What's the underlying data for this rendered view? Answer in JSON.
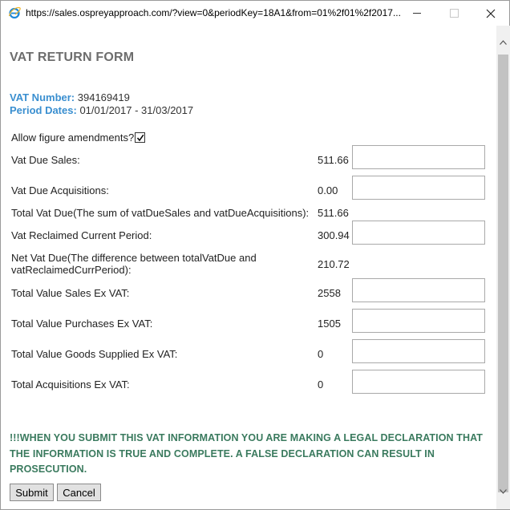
{
  "window": {
    "url": "https://sales.ospreyapproach.com/?view=0&periodKey=18A1&from=01%2f01%2f2017..."
  },
  "form": {
    "title": "VAT RETURN FORM",
    "vat_number_label": "VAT Number:",
    "vat_number": "394169419",
    "period_label": "Period Dates:",
    "period": "01/01/2017 - 31/03/2017",
    "allow_amend_label": "Allow figure amendments?",
    "allow_amend_checked": true,
    "fields": [
      {
        "label": "Vat Due Sales:",
        "value": "511.66",
        "has_input": true,
        "input_value": ""
      },
      {
        "label": "Vat Due Acquisitions:",
        "value": "0.00",
        "has_input": true,
        "input_value": ""
      },
      {
        "label": "Total Vat Due(The sum of vatDueSales and vatDueAcquisitions):",
        "value": "511.66",
        "has_input": false
      },
      {
        "label": "Vat Reclaimed Current Period:",
        "value": "300.94",
        "has_input": true,
        "input_value": ""
      },
      {
        "label": "Net Vat Due(The difference between totalVatDue and vatReclaimedCurrPeriod):",
        "value": "210.72",
        "has_input": false
      },
      {
        "label": "Total Value Sales Ex VAT:",
        "value": "2558",
        "has_input": true,
        "input_value": ""
      },
      {
        "label": "Total Value Purchases Ex VAT:",
        "value": "1505",
        "has_input": true,
        "input_value": ""
      },
      {
        "label": "Total Value Goods Supplied Ex VAT:",
        "value": "0",
        "has_input": true,
        "input_value": ""
      },
      {
        "label": "Total Acquisitions Ex VAT:",
        "value": "0",
        "has_input": true,
        "input_value": ""
      }
    ],
    "legal_text": "!!!WHEN YOU SUBMIT THIS VAT INFORMATION YOU ARE MAKING A LEGAL DECLARATION THAT THE INFORMATION IS TRUE AND COMPLETE. A FALSE DECLARATION CAN RESULT IN PROSECUTION.",
    "submit_label": "Submit",
    "cancel_label": "Cancel"
  },
  "colors": {
    "accent_blue": "#3a8fd0",
    "legal_green": "#3a7a5e",
    "title_gray": "#6d6d6d"
  }
}
